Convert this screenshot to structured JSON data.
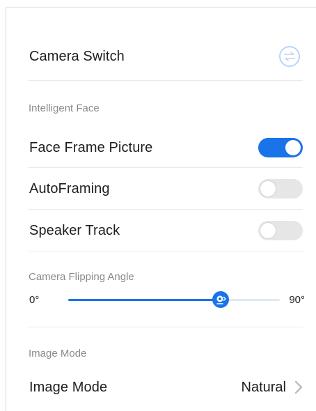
{
  "camera_switch": {
    "label": "Camera Switch",
    "icon": "swap-arrows-icon",
    "icon_color": "#b9d4f7"
  },
  "intelligent_face": {
    "section_title": "Intelligent Face",
    "items": [
      {
        "label": "Face Frame Picture",
        "enabled": true
      },
      {
        "label": "AutoFraming",
        "enabled": false
      },
      {
        "label": "Speaker Track",
        "enabled": false
      }
    ]
  },
  "camera_flipping": {
    "section_title": "Camera Flipping Angle",
    "min_label": "0°",
    "max_label": "90°",
    "value_fraction": 0.72
  },
  "image_mode": {
    "section_title": "Image Mode",
    "row_label": "Image Mode",
    "value": "Natural",
    "chevron_icon": "chevron-right-icon"
  },
  "colors": {
    "accent": "#1a73e8",
    "toggle_off": "#e6e6e6",
    "section_title": "#8a8a8a"
  }
}
